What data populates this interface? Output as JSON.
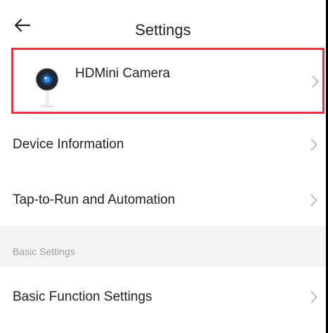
{
  "header": {
    "title": "Settings",
    "back_icon": "arrow-left-icon"
  },
  "device": {
    "name": "HDMini Camera",
    "icon": "camera-icon",
    "highlight_color": "#e5363d"
  },
  "rows": {
    "device_information": "Device Information",
    "tap_to_run": "Tap-to-Run and Automation",
    "basic_function_settings": "Basic Function Settings"
  },
  "sections": {
    "basic_settings": "Basic Settings"
  },
  "icons": {
    "chevron": "chevron-right-icon"
  },
  "colors": {
    "background": "#ffffff",
    "section_background": "#f4f4f4",
    "section_text": "#9a9a9a",
    "text": "#222222",
    "chevron": "#aaaaaa"
  }
}
